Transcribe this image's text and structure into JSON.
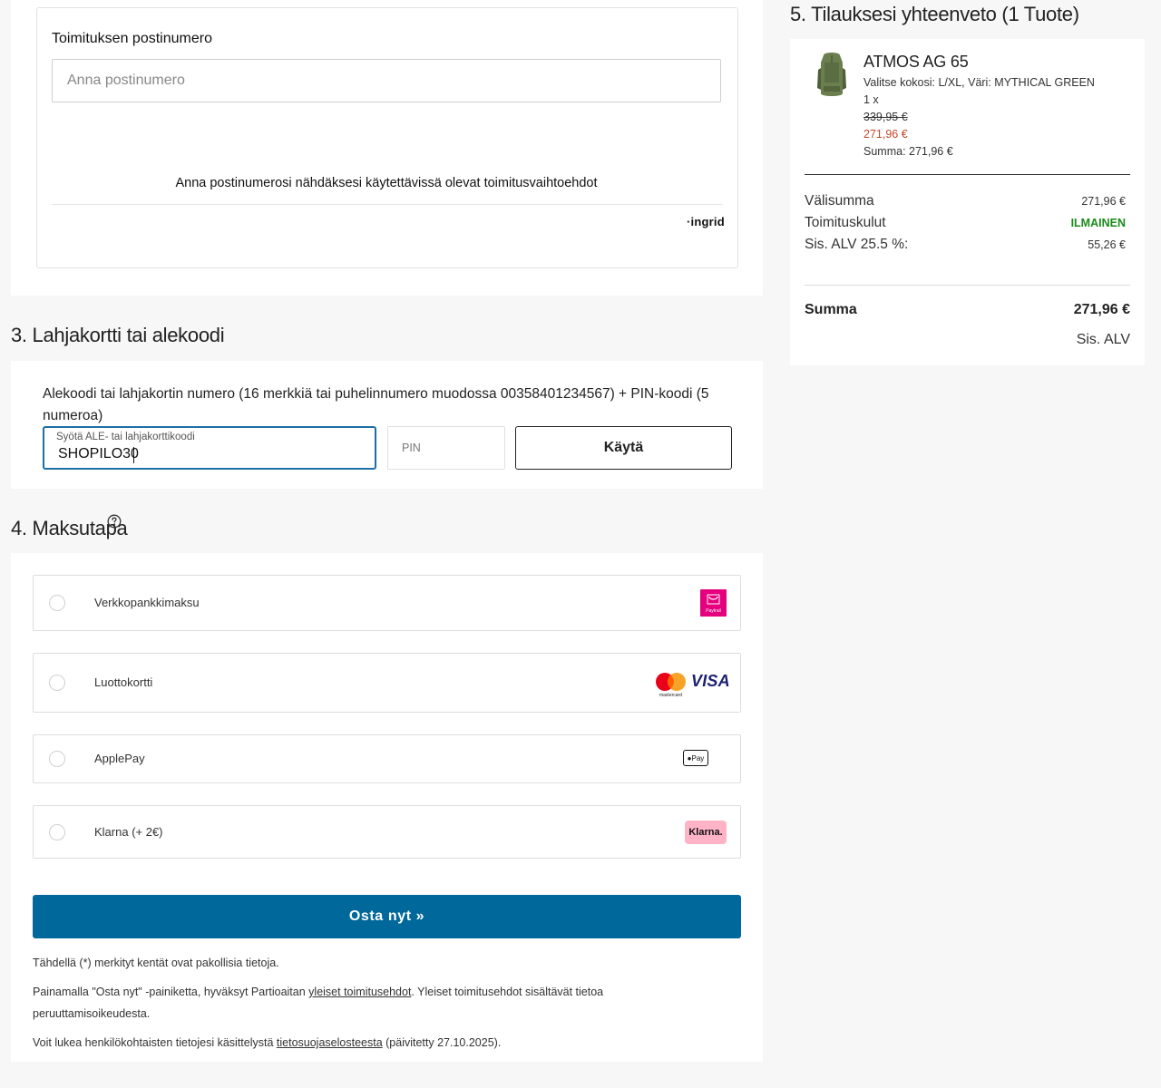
{
  "shipping": {
    "label": "Toimituksen postinumero",
    "postal_placeholder": "Anna postinumero",
    "postal_value": "",
    "hint": "Anna postinumerosi nähdäksesi käytettävissä olevat toimitusvaihtoehdot",
    "provider_logo_text": "·ingrid"
  },
  "gift": {
    "heading": "3. Lahjakortti tai alekoodi",
    "description": "Alekoodi tai lahjakortin numero (16 merkkiä tai puhelinnumero muodossa 00358401234567) + PIN-koodi (5 numeroa)",
    "code_label": "Syötä ALE- tai lahjakorttikoodi",
    "code_value": "SHOPILO30",
    "pin_label": "PIN",
    "apply_label": "Käytä"
  },
  "payment": {
    "heading": "4. Maksutapa",
    "help_icon": "question-circle-icon",
    "options": [
      {
        "label": "Verkkopankkimaksu",
        "icon": "paytrail-logo",
        "icon_text": "Paytrail"
      },
      {
        "label": "Luottokortti",
        "icon": "mastercard-visa-logo",
        "icon_text_mc": "mastercard",
        "icon_text_visa": "VISA"
      },
      {
        "label": "ApplePay",
        "icon": "apple-pay-logo",
        "icon_text": "Pay"
      },
      {
        "label": "Klarna (+ 2€)",
        "icon": "klarna-logo",
        "icon_text": "Klarna."
      }
    ],
    "buy_label": "Osta nyt »",
    "note_required": "Tähdellä (*) merkityt kentät ovat pakollisia tietoja.",
    "note_terms_pre": "Painamalla \"Osta nyt\" -painiketta, hyväksyt Partioaitan ",
    "note_terms_link": "yleiset toimitusehdot",
    "note_terms_post": ". Yleiset toimitusehdot sisältävät tietoa peruuttamisoikeudesta.",
    "note_privacy_pre": "Voit lukea henkilökohtaisten tietojesi käsittelystä ",
    "note_privacy_link": "tietosuojaselosteesta",
    "note_privacy_post": " (päivitetty 27.10.2025)."
  },
  "summary": {
    "heading": "5. Tilauksesi yhteenveto (1 Tuote)",
    "product": {
      "name": "ATMOS AG 65",
      "variant": "Valitse kokosi: L/XL, Väri: MYTHICAL GREEN",
      "qty": "1 x",
      "old_price": "339,95 €",
      "new_price": "271,96 €",
      "line_total": "Summa: 271,96 €"
    },
    "rows": [
      {
        "label": "Välisumma",
        "value": "271,96 €"
      },
      {
        "label": "Toimituskulut",
        "value": "ILMAINEN"
      },
      {
        "label": "Sis. ALV 25.5 %:",
        "value": "55,26 €"
      }
    ],
    "total_label": "Summa",
    "total_value": "271,96 €",
    "vat_note": "Sis. ALV"
  },
  "colors": {
    "primary_button": "#00689a",
    "sale_price": "#c0492b",
    "free_shipping": "#1a8a1a",
    "input_focus": "#1d6fa5"
  }
}
